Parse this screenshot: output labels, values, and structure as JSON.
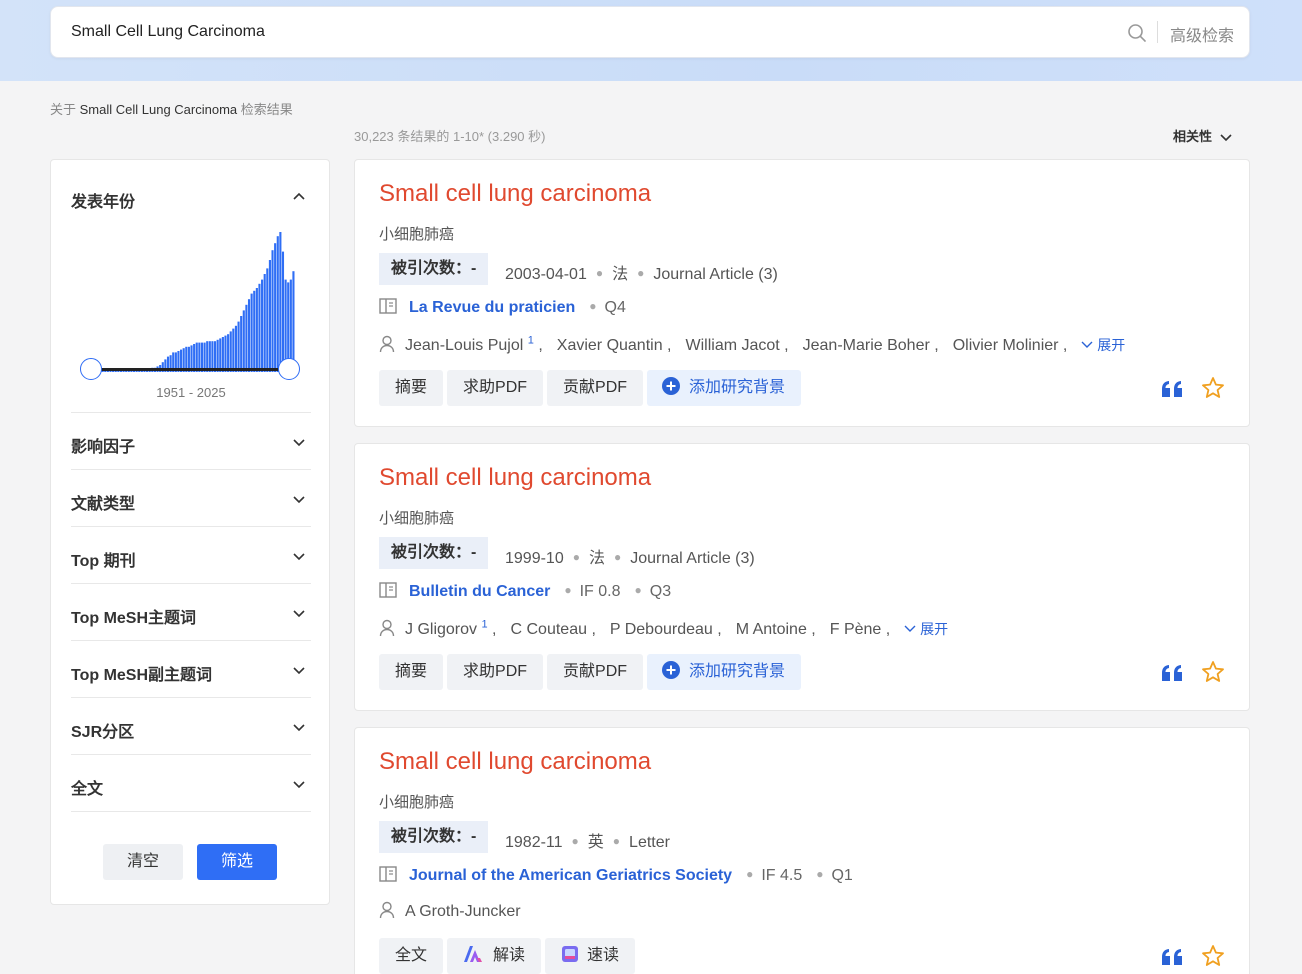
{
  "search": {
    "query": "Small Cell Lung Carcinoma",
    "advanced_label": "高级检索"
  },
  "results_header": {
    "prefix": "关于 ",
    "query": "Small Cell Lung Carcinoma",
    "suffix": " 检索结果",
    "count_text": "30,223 条结果的 1-10* (3.290 秒)",
    "sort_label": "相关性"
  },
  "sidebar": {
    "year_filter": {
      "label": "发表年份",
      "range_text": "1951 - 2025"
    },
    "filters": [
      "影响因子",
      "文献类型",
      "Top 期刊",
      "Top MeSH主题词",
      "Top MeSH副主题词",
      "SJR分区",
      "全文"
    ],
    "clear_label": "清空",
    "filter_label": "筛选"
  },
  "chart_data": {
    "type": "bar",
    "title": "",
    "x_range": [
      1951,
      2025
    ],
    "values": [
      2,
      2,
      2,
      2,
      2,
      2,
      2,
      2,
      2,
      2,
      2,
      2,
      2,
      2,
      2,
      2,
      2,
      2,
      2,
      2,
      3,
      3,
      4,
      5,
      7,
      9,
      11,
      12,
      14,
      14,
      15,
      16,
      17,
      18,
      18,
      19,
      20,
      21,
      21,
      21,
      21,
      22,
      22,
      22,
      22,
      23,
      24,
      25,
      26,
      27,
      29,
      31,
      33,
      36,
      40,
      44,
      48,
      52,
      56,
      58,
      60,
      63,
      66,
      70,
      74,
      80,
      87,
      92,
      97,
      100,
      86,
      66,
      64,
      66,
      72
    ],
    "ylim": [
      0,
      100
    ],
    "color": "#2f6ef5"
  },
  "results": [
    {
      "title": "Small cell lung carcinoma",
      "subtitle": "小细胞肺癌",
      "cite_label": "被引次数：-",
      "date": "2003-04-01",
      "lang": "法",
      "type": "Journal Article (3)",
      "journal": "La Revue du praticien",
      "metrics": [
        "Q4"
      ],
      "authors": [
        {
          "name": "Jean-Louis Pujol",
          "sup": "1"
        },
        {
          "name": "Xavier Quantin"
        },
        {
          "name": "William Jacot"
        },
        {
          "name": "Jean-Marie Boher"
        },
        {
          "name": "Olivier Molinier"
        }
      ],
      "expand": "展开",
      "buttons": [
        "摘要",
        "求助PDF",
        "贡献PDF"
      ],
      "add_label": "添加研究背景"
    },
    {
      "title": "Small cell lung carcinoma",
      "subtitle": "小细胞肺癌",
      "cite_label": "被引次数：-",
      "date": "1999-10",
      "lang": "法",
      "type": "Journal Article (3)",
      "journal": "Bulletin du Cancer",
      "metrics": [
        "IF 0.8",
        "Q3"
      ],
      "authors": [
        {
          "name": "J Gligorov",
          "sup": "1"
        },
        {
          "name": "C Couteau"
        },
        {
          "name": "P Debourdeau"
        },
        {
          "name": "M Antoine"
        },
        {
          "name": "F Pène"
        }
      ],
      "expand": "展开",
      "buttons": [
        "摘要",
        "求助PDF",
        "贡献PDF"
      ],
      "add_label": "添加研究背景"
    },
    {
      "title": "Small cell lung carcinoma",
      "subtitle": "小细胞肺癌",
      "cite_label": "被引次数：-",
      "date": "1982-11",
      "lang": "英",
      "type": "Letter",
      "journal": "Journal of the American Geriatrics Society",
      "metrics": [
        "IF 4.5",
        "Q1"
      ],
      "authors": [
        {
          "name": "A Groth-Juncker"
        }
      ],
      "buttons": [
        "全文",
        "解读",
        "速读"
      ]
    }
  ],
  "colors": {
    "accent": "#2f6ef5",
    "title_red": "#e0492f",
    "link_blue": "#2a62d6",
    "star": "#f0a020"
  }
}
